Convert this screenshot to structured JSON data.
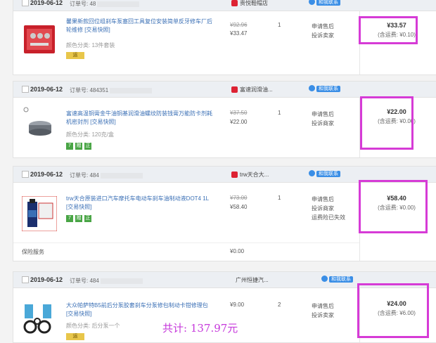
{
  "orders": [
    {
      "date": "2019-06-12",
      "order_no": "订单号: 48",
      "shop": "贵悦鞋帽店",
      "contact": "和我联系",
      "desc": "馨果新款回位组刹车泵塞回工具复位安装简单反牙修车厂后轮维修 [交易快照]",
      "attr": "颜色分类: 13件套装",
      "badges": [
        "运"
      ],
      "orig_price": "¥92.96",
      "price": "¥33.47",
      "qty": "1",
      "actions": [
        "申请售后",
        "投诉卖家"
      ],
      "total": "¥33.57",
      "shipping": "(含运费: ¥0.10)"
    },
    {
      "date": "2019-06-12",
      "order_no": "订单号: 484351",
      "shop": "富速润滑油...",
      "contact": "和我联系",
      "desc": "富速高温铜膏金牛油铜基润滑油螺纹防装钱膏万能防卡剂耗机密封剂 [交易快照]",
      "attr": "颜色分类: 120克/盒",
      "badges": [
        "7",
        "赠",
        "正"
      ],
      "orig_price": "¥37.50",
      "price": "¥22.00",
      "qty": "1",
      "actions": [
        "申请售后",
        "投诉商家"
      ],
      "total": "¥22.00",
      "shipping": "(含运费: ¥0.00)"
    },
    {
      "date": "2019-06-12",
      "order_no": "订单号: 484",
      "shop": "trw天合大...",
      "contact": "和我联系",
      "desc": "trw天合原装进口汽车摩托车电动车刹车油制动液DOT4 1L [交易快照]",
      "attr": "",
      "badges": [
        "7",
        "赠",
        "正"
      ],
      "orig_price": "¥73.00",
      "price": "¥58.40",
      "qty": "1",
      "actions": [
        "申请售后",
        "投诉商家",
        "运费险已失效"
      ],
      "total": "¥58.40",
      "shipping": "(含运费: ¥0.00)",
      "service_label": "保险服务",
      "service_price": "¥0.00"
    },
    {
      "date": "2019-06-12",
      "order_no": "订单号: 484",
      "shop": "广州恒捷汽...",
      "contact": "和我联系",
      "desc": "大众帕萨特B5前后分泵胶套刹车分泵修包制动卡钳修理包 [交易快照]",
      "attr": "颜色分类: 后分泵一个",
      "badges": [
        "运"
      ],
      "orig_price": "",
      "price": "¥9.00",
      "qty": "2",
      "actions": [
        "申请售后",
        "投诉卖家"
      ],
      "total": "¥24.00",
      "shipping": "(含运费: ¥6.00)"
    }
  ],
  "grand_total": "共计: 137.97元",
  "colors": {
    "highlight": "#d63bd6",
    "link": "#3a6fb5",
    "header_bg": "#eceff3"
  }
}
